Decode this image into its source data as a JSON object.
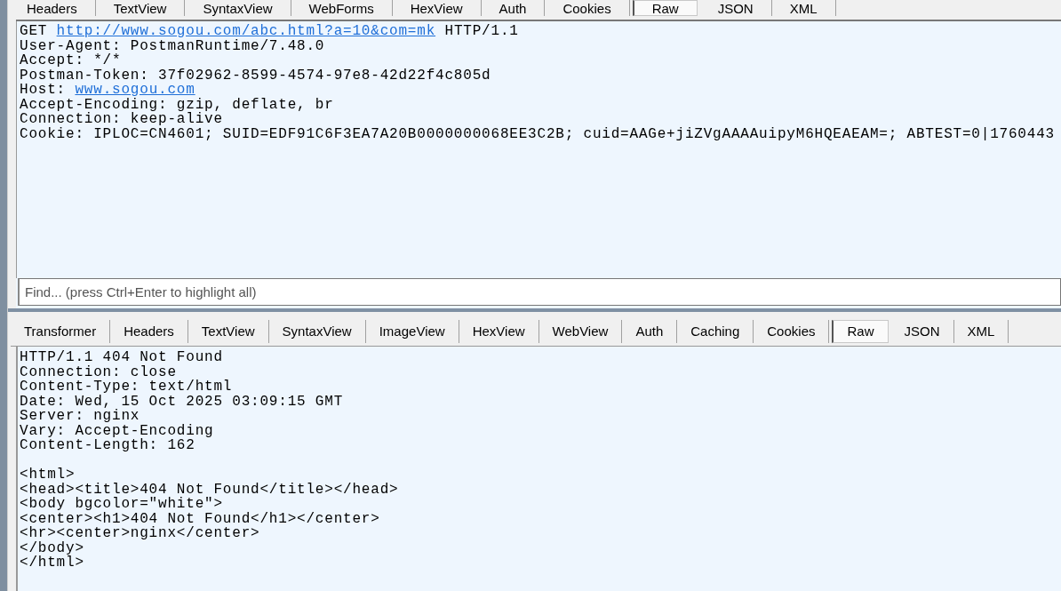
{
  "request_tabs": [
    {
      "label": "Headers",
      "selected": false
    },
    {
      "label": "TextView",
      "selected": false
    },
    {
      "label": "SyntaxView",
      "selected": false
    },
    {
      "label": "WebForms",
      "selected": false
    },
    {
      "label": "HexView",
      "selected": false
    },
    {
      "label": "Auth",
      "selected": false
    },
    {
      "label": "Cookies",
      "selected": false
    },
    {
      "label": "Raw",
      "selected": true
    },
    {
      "label": "JSON",
      "selected": false
    },
    {
      "label": "XML",
      "selected": false
    }
  ],
  "request_lines": [
    [
      {
        "kind": "plain",
        "text": "GET "
      },
      {
        "kind": "link",
        "text": "http://www.sogou.com/abc.html?a=10&com=mk"
      },
      {
        "kind": "plain",
        "text": " HTTP/1.1"
      }
    ],
    [
      {
        "kind": "plain",
        "text": "User-Agent: PostmanRuntime/7.48.0"
      }
    ],
    [
      {
        "kind": "plain",
        "text": "Accept: */*"
      }
    ],
    [
      {
        "kind": "plain",
        "text": "Postman-Token: 37f02962-8599-4574-97e8-42d22f4c805d"
      }
    ],
    [
      {
        "kind": "plain",
        "text": "Host: "
      },
      {
        "kind": "link",
        "text": "www.sogou.com"
      }
    ],
    [
      {
        "kind": "plain",
        "text": "Accept-Encoding: gzip, deflate, br"
      }
    ],
    [
      {
        "kind": "plain",
        "text": "Connection: keep-alive"
      }
    ],
    [
      {
        "kind": "plain",
        "text": "Cookie: IPLOC=CN4601; SUID=EDF91C6F3EA7A20B0000000068EE3C2B; cuid=AAGe+jiZVgAAAAuipyM6HQEAEAM=; ABTEST=0|1760443"
      }
    ]
  ],
  "find": {
    "placeholder": "Find... (press Ctrl+Enter to highlight all)"
  },
  "response_tabs": [
    {
      "label": "Transformer",
      "selected": false
    },
    {
      "label": "Headers",
      "selected": false
    },
    {
      "label": "TextView",
      "selected": false
    },
    {
      "label": "SyntaxView",
      "selected": false
    },
    {
      "label": "ImageView",
      "selected": false
    },
    {
      "label": "HexView",
      "selected": false
    },
    {
      "label": "WebView",
      "selected": false
    },
    {
      "label": "Auth",
      "selected": false
    },
    {
      "label": "Caching",
      "selected": false
    },
    {
      "label": "Cookies",
      "selected": false
    },
    {
      "label": "Raw",
      "selected": true
    },
    {
      "label": "JSON",
      "selected": false
    },
    {
      "label": "XML",
      "selected": false
    }
  ],
  "response": {
    "headers": [
      "HTTP/1.1 404 Not Found",
      "Connection: close",
      "Content-Type: text/html",
      "Date: Wed, 15 Oct 2025 03:09:15 GMT",
      "Server: nginx",
      "Vary: Accept-Encoding",
      "Content-Length: 162"
    ],
    "body": [
      "<html>",
      "<head><title>404 Not Found</title></head>",
      "<body bgcolor=\"white\">",
      "<center><h1>404 Not Found</h1></center>",
      "<hr><center>nginx</center>",
      "</body>",
      "</html>"
    ]
  }
}
